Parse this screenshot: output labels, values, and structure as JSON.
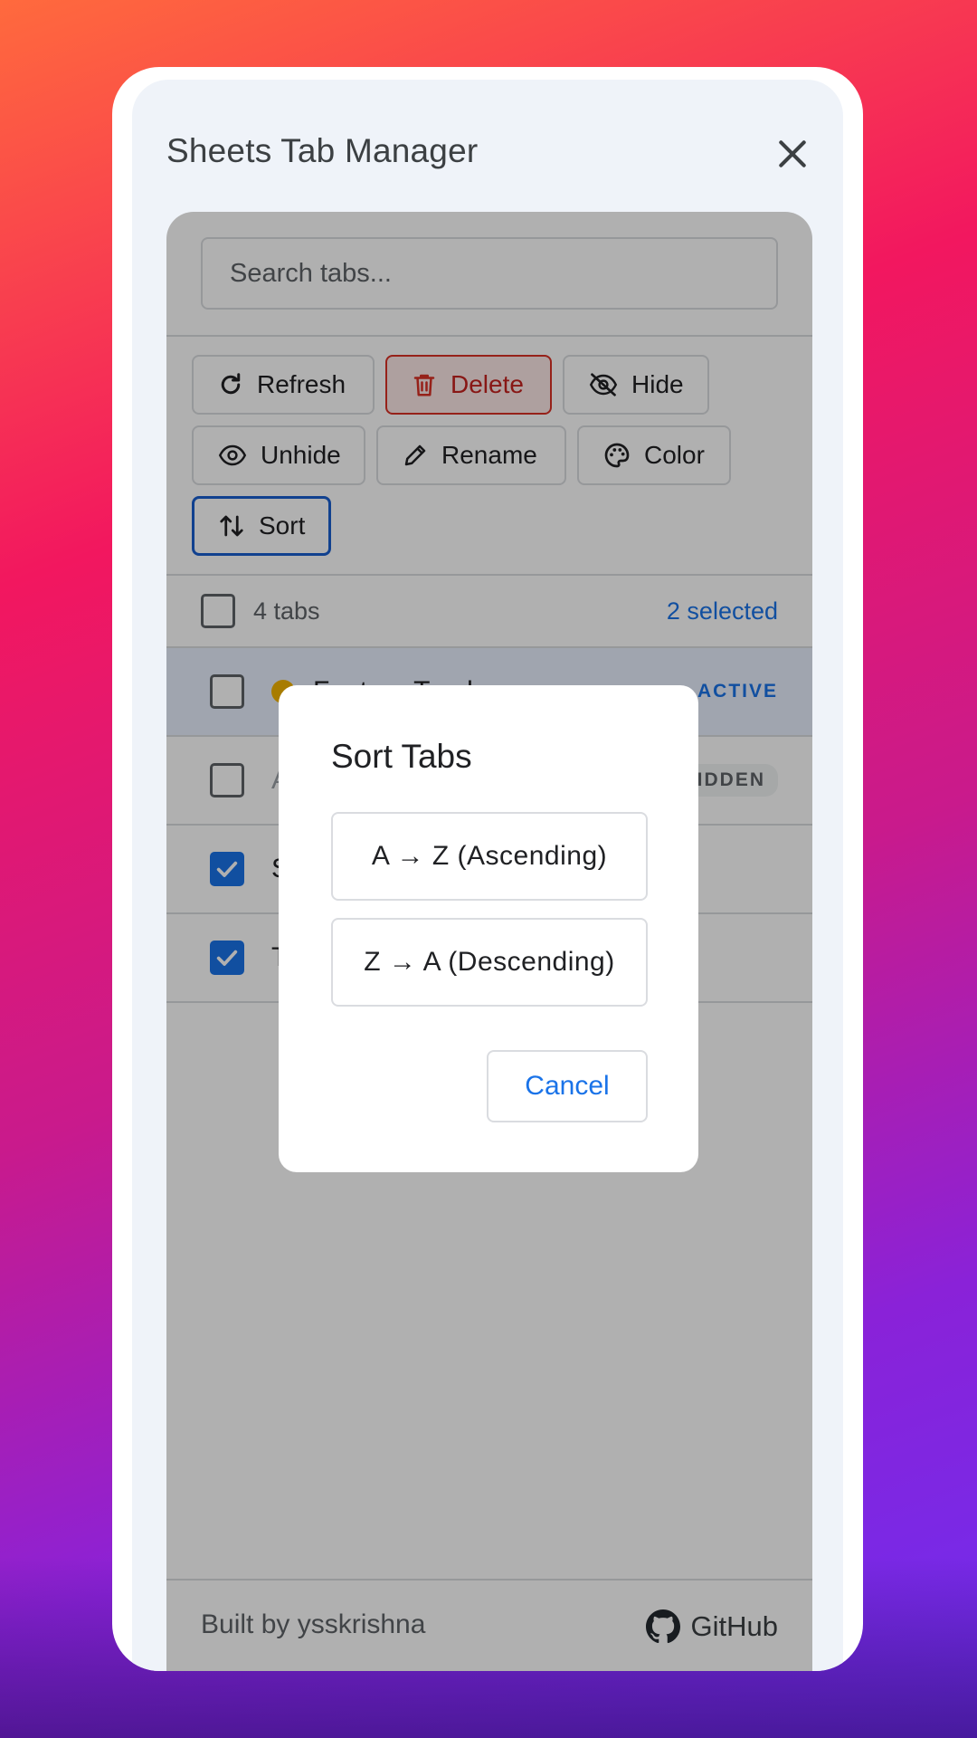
{
  "app": {
    "title": "Sheets Tab Manager"
  },
  "search": {
    "placeholder": "Search tabs..."
  },
  "toolbar": {
    "refresh_label": "Refresh",
    "delete_label": "Delete",
    "hide_label": "Hide",
    "unhide_label": "Unhide",
    "rename_label": "Rename",
    "color_label": "Color",
    "sort_label": "Sort"
  },
  "summary": {
    "count_label": "4 tabs",
    "selected_label": "2 selected"
  },
  "tabs": [
    {
      "name": "Feature Tracker",
      "badge": "ACTIVE",
      "color": "#f4b400",
      "checked": false
    },
    {
      "name": "A",
      "badge": "HIDDEN",
      "checked": false
    },
    {
      "name": "S",
      "checked": true
    },
    {
      "name": "T",
      "checked": true
    }
  ],
  "footer": {
    "built_by": "Built by ysskrishna",
    "github_label": "GitHub"
  },
  "modal": {
    "title": "Sort Tabs",
    "ascending_label": "A → Z (Ascending)",
    "descending_label": "Z → A (Descending)",
    "cancel_label": "Cancel"
  },
  "colors": {
    "accent": "#1a73e8",
    "danger": "#d93025",
    "active_row": "#e8f0fe"
  }
}
